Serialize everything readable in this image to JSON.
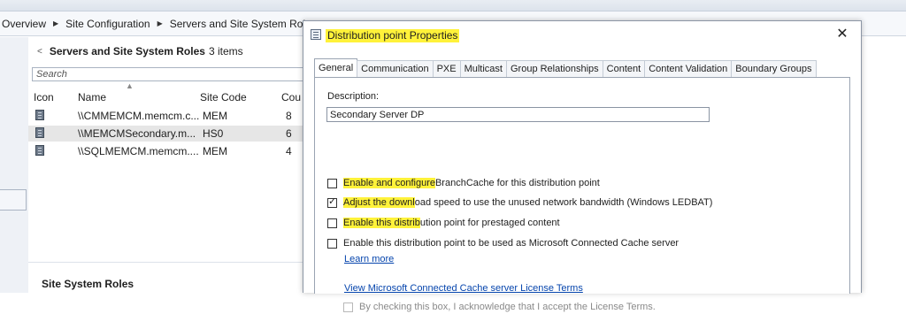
{
  "breadcrumb": {
    "items": [
      "Overview",
      "Site Configuration",
      "Servers and Site System Roles"
    ]
  },
  "list_panel": {
    "title": "Servers and Site System Roles",
    "count": "3 items",
    "search_placeholder": "Search",
    "columns": [
      "Icon",
      "Name",
      "Site Code",
      "Cou"
    ],
    "rows": [
      {
        "name": "\\\\CMMEMCM.memcm.c...",
        "site_code": "MEM",
        "count": "8",
        "selected": false
      },
      {
        "name": "\\\\MEMCMSecondary.m...",
        "site_code": "HS0",
        "count": "6",
        "selected": true
      },
      {
        "name": "\\\\SQLMEMCM.memcm....",
        "site_code": "MEM",
        "count": "4",
        "selected": false
      }
    ],
    "roles_section_title": "Site System Roles"
  },
  "dialog": {
    "title": "Distribution point Properties",
    "close_glyph": "✕",
    "tabs": [
      "General",
      "Communication",
      "PXE",
      "Multicast",
      "Group Relationships",
      "Content",
      "Content Validation",
      "Boundary Groups"
    ],
    "active_tab": "General",
    "description_label": "Description:",
    "description_value": "Secondary Server DP",
    "options": [
      {
        "hl": "Enable and configure",
        "rest": " BranchCache for this distribution point",
        "checked": false
      },
      {
        "hl": "Adjust the downl",
        "rest": "oad speed to use the unused network bandwidth (Windows LEDBAT)",
        "checked": true
      },
      {
        "hl": "Enable this distrib",
        "rest": "ution point for prestaged content",
        "checked": false
      },
      {
        "hl": "",
        "rest": "Enable this distribution point to be used as Microsoft Connected Cache server",
        "checked": false
      }
    ],
    "learn_more": "Learn more",
    "license_link": "View Microsoft Connected Cache server License Terms",
    "license_ack": "By checking this box, I acknowledge that I accept the License Terms.",
    "highlight_color": "#fff23a"
  }
}
